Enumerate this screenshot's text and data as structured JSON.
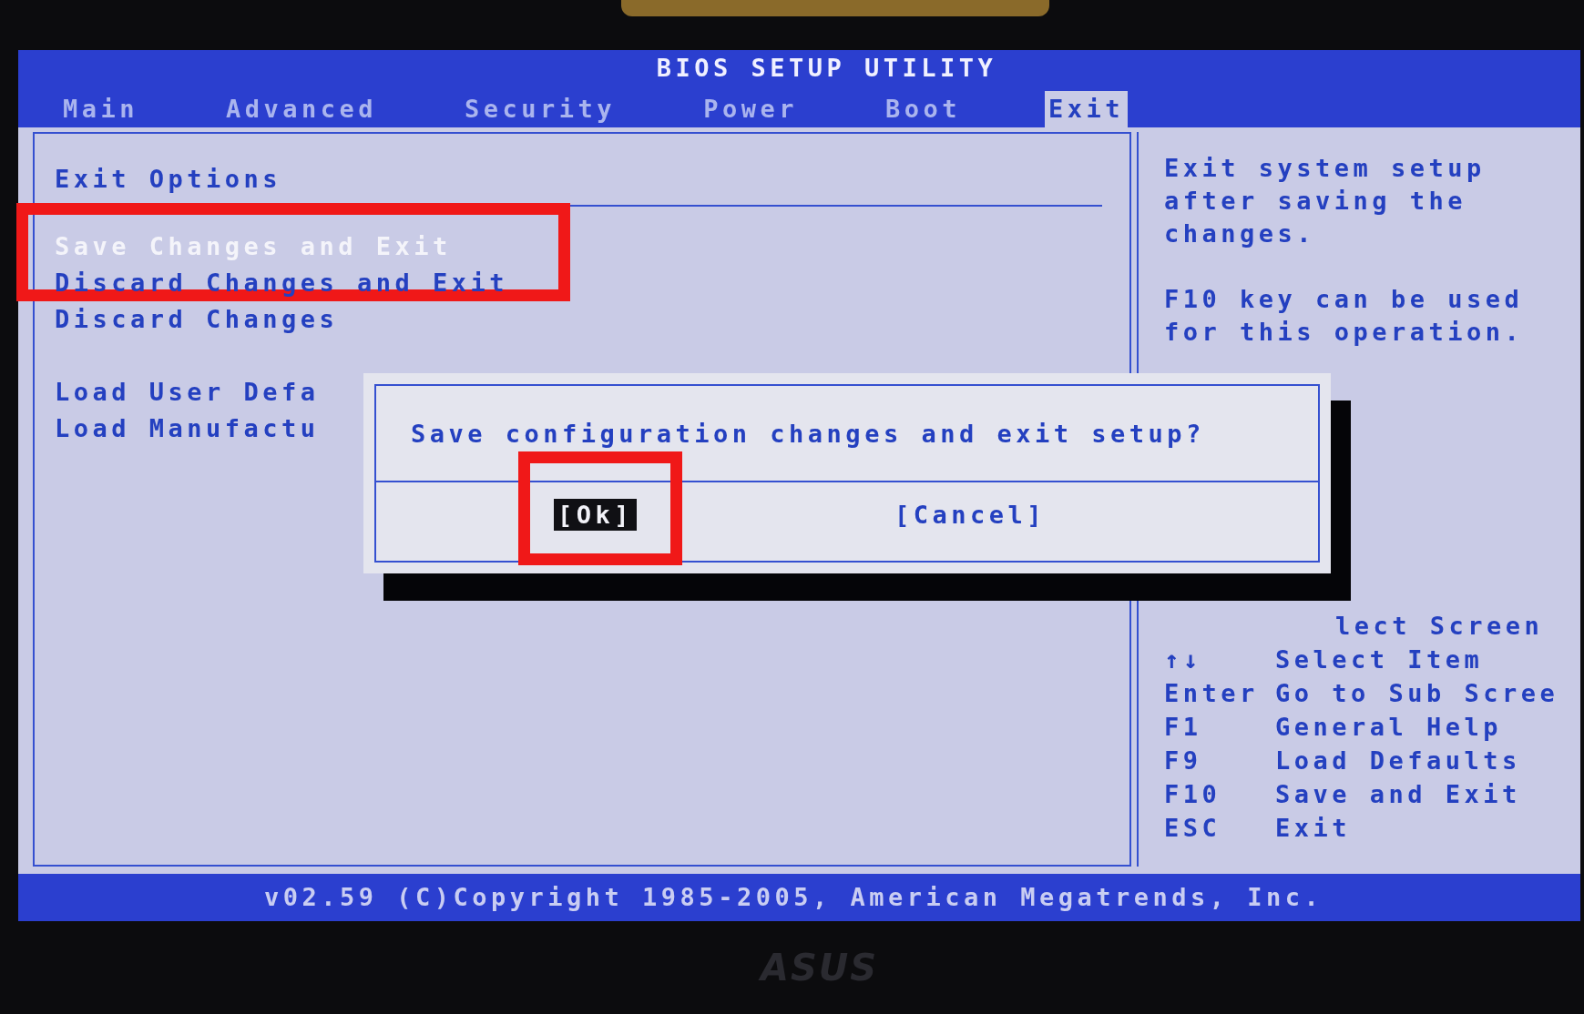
{
  "screen_title": "BIOS SETUP UTILITY",
  "tabs": [
    {
      "label": "Main",
      "selected": false
    },
    {
      "label": "Advanced",
      "selected": false
    },
    {
      "label": "Security",
      "selected": false
    },
    {
      "label": "Power",
      "selected": false
    },
    {
      "label": "Boot",
      "selected": false
    },
    {
      "label": "Exit",
      "selected": true
    }
  ],
  "exit_options": {
    "heading": "Exit Options",
    "groups": [
      {
        "items": [
          {
            "label": "Save Changes and Exit",
            "selected": true,
            "highlighted": true
          },
          {
            "label": "Discard Changes and Exit",
            "selected": false,
            "highlighted": false
          },
          {
            "label": "Discard Changes",
            "selected": false,
            "highlighted": false
          }
        ]
      },
      {
        "items": [
          {
            "label": "Load User Defa",
            "selected": false,
            "highlighted": false
          },
          {
            "label": "Load Manufactu",
            "selected": false,
            "highlighted": false
          }
        ]
      }
    ]
  },
  "help": {
    "paragraphs": [
      "Exit system setup after saving the changes.",
      "F10 key can be used for this operation."
    ]
  },
  "key_legend": [
    {
      "action": "lect Screen"
    },
    {
      "key": "↑↓",
      "action": "Select Item"
    },
    {
      "key": "Enter",
      "action": "Go to Sub Scree"
    },
    {
      "key": "F1",
      "action": "General Help"
    },
    {
      "key": "F9",
      "action": "Load Defaults"
    },
    {
      "key": "F10",
      "action": "Save and Exit"
    },
    {
      "key": "ESC",
      "action": "Exit"
    }
  ],
  "dialog": {
    "message": "Save configuration changes and exit setup?",
    "buttons": [
      {
        "label": "[Ok]",
        "selected": true,
        "highlighted": true
      },
      {
        "label": "[Cancel]",
        "selected": false,
        "highlighted": false
      }
    ]
  },
  "footer": "v02.59 (C)Copyright 1985-2005, American Megatrends, Inc.",
  "bezel": {
    "logo": "ASUS"
  }
}
